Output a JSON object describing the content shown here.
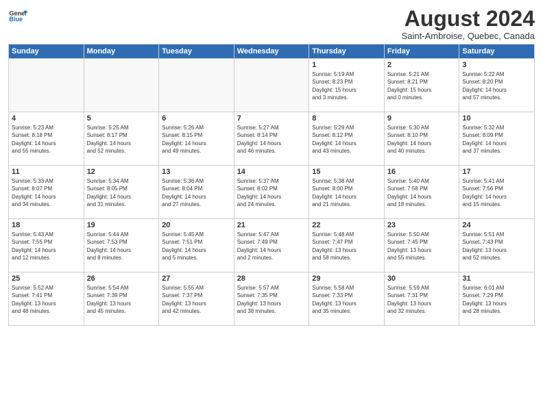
{
  "header": {
    "logo_general": "General",
    "logo_blue": "Blue",
    "title": "August 2024",
    "subtitle": "Saint-Ambroise, Quebec, Canada"
  },
  "days_of_week": [
    "Sunday",
    "Monday",
    "Tuesday",
    "Wednesday",
    "Thursday",
    "Friday",
    "Saturday"
  ],
  "weeks": [
    [
      {
        "day": "",
        "info": ""
      },
      {
        "day": "",
        "info": ""
      },
      {
        "day": "",
        "info": ""
      },
      {
        "day": "",
        "info": ""
      },
      {
        "day": "1",
        "info": "Sunrise: 5:19 AM\nSunset: 8:23 PM\nDaylight: 15 hours\nand 3 minutes."
      },
      {
        "day": "2",
        "info": "Sunrise: 5:21 AM\nSunset: 8:21 PM\nDaylight: 15 hours\nand 0 minutes."
      },
      {
        "day": "3",
        "info": "Sunrise: 5:22 AM\nSunset: 8:20 PM\nDaylight: 14 hours\nand 57 minutes."
      }
    ],
    [
      {
        "day": "4",
        "info": "Sunrise: 5:23 AM\nSunset: 8:18 PM\nDaylight: 14 hours\nand 55 minutes."
      },
      {
        "day": "5",
        "info": "Sunrise: 5:25 AM\nSunset: 8:17 PM\nDaylight: 14 hours\nand 52 minutes."
      },
      {
        "day": "6",
        "info": "Sunrise: 5:26 AM\nSunset: 8:15 PM\nDaylight: 14 hours\nand 49 minutes."
      },
      {
        "day": "7",
        "info": "Sunrise: 5:27 AM\nSunset: 8:14 PM\nDaylight: 14 hours\nand 46 minutes."
      },
      {
        "day": "8",
        "info": "Sunrise: 5:29 AM\nSunset: 8:12 PM\nDaylight: 14 hours\nand 43 minutes."
      },
      {
        "day": "9",
        "info": "Sunrise: 5:30 AM\nSunset: 8:10 PM\nDaylight: 14 hours\nand 40 minutes."
      },
      {
        "day": "10",
        "info": "Sunrise: 5:32 AM\nSunset: 8:09 PM\nDaylight: 14 hours\nand 37 minutes."
      }
    ],
    [
      {
        "day": "11",
        "info": "Sunrise: 5:33 AM\nSunset: 8:07 PM\nDaylight: 14 hours\nand 34 minutes."
      },
      {
        "day": "12",
        "info": "Sunrise: 5:34 AM\nSunset: 8:05 PM\nDaylight: 14 hours\nand 31 minutes."
      },
      {
        "day": "13",
        "info": "Sunrise: 5:36 AM\nSunset: 8:04 PM\nDaylight: 14 hours\nand 27 minutes."
      },
      {
        "day": "14",
        "info": "Sunrise: 5:37 AM\nSunset: 8:02 PM\nDaylight: 14 hours\nand 24 minutes."
      },
      {
        "day": "15",
        "info": "Sunrise: 5:38 AM\nSunset: 8:00 PM\nDaylight: 14 hours\nand 21 minutes."
      },
      {
        "day": "16",
        "info": "Sunrise: 5:40 AM\nSunset: 7:58 PM\nDaylight: 14 hours\nand 18 minutes."
      },
      {
        "day": "17",
        "info": "Sunrise: 5:41 AM\nSunset: 7:56 PM\nDaylight: 14 hours\nand 15 minutes."
      }
    ],
    [
      {
        "day": "18",
        "info": "Sunrise: 5:43 AM\nSunset: 7:55 PM\nDaylight: 14 hours\nand 12 minutes."
      },
      {
        "day": "19",
        "info": "Sunrise: 5:44 AM\nSunset: 7:53 PM\nDaylight: 14 hours\nand 8 minutes."
      },
      {
        "day": "20",
        "info": "Sunrise: 5:45 AM\nSunset: 7:51 PM\nDaylight: 14 hours\nand 5 minutes."
      },
      {
        "day": "21",
        "info": "Sunrise: 5:47 AM\nSunset: 7:49 PM\nDaylight: 14 hours\nand 2 minutes."
      },
      {
        "day": "22",
        "info": "Sunrise: 5:48 AM\nSunset: 7:47 PM\nDaylight: 13 hours\nand 58 minutes."
      },
      {
        "day": "23",
        "info": "Sunrise: 5:50 AM\nSunset: 7:45 PM\nDaylight: 13 hours\nand 55 minutes."
      },
      {
        "day": "24",
        "info": "Sunrise: 5:51 AM\nSunset: 7:43 PM\nDaylight: 13 hours\nand 52 minutes."
      }
    ],
    [
      {
        "day": "25",
        "info": "Sunrise: 5:52 AM\nSunset: 7:41 PM\nDaylight: 13 hours\nand 48 minutes."
      },
      {
        "day": "26",
        "info": "Sunrise: 5:54 AM\nSunset: 7:39 PM\nDaylight: 13 hours\nand 45 minutes."
      },
      {
        "day": "27",
        "info": "Sunrise: 5:55 AM\nSunset: 7:37 PM\nDaylight: 13 hours\nand 42 minutes."
      },
      {
        "day": "28",
        "info": "Sunrise: 5:57 AM\nSunset: 7:35 PM\nDaylight: 13 hours\nand 38 minutes."
      },
      {
        "day": "29",
        "info": "Sunrise: 5:58 AM\nSunset: 7:33 PM\nDaylight: 13 hours\nand 35 minutes."
      },
      {
        "day": "30",
        "info": "Sunrise: 5:59 AM\nSunset: 7:31 PM\nDaylight: 13 hours\nand 32 minutes."
      },
      {
        "day": "31",
        "info": "Sunrise: 6:01 AM\nSunset: 7:29 PM\nDaylight: 13 hours\nand 28 minutes."
      }
    ]
  ]
}
